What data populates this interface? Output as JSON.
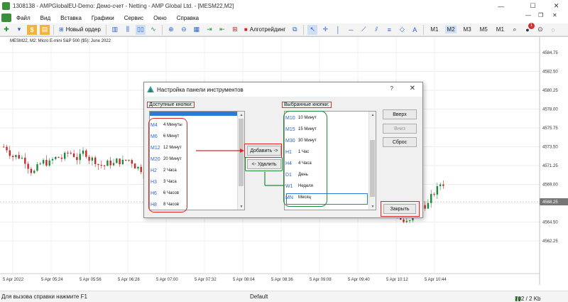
{
  "window": {
    "title": "1308138 - AMPGlobalEU-Demo: Демо-счет - Netting - AMP Global Ltd. - [MESM22,M2]",
    "minimize": "—",
    "maximize": "☐",
    "close": "✕"
  },
  "menu": {
    "items": [
      "Файл",
      "Вид",
      "Вставка",
      "Графики",
      "Сервис",
      "Окно",
      "Справка"
    ],
    "mdi_minimize": "—",
    "mdi_restore": "❐",
    "mdi_close": "✕"
  },
  "toolbar": {
    "new_order_label": "Новый ордер",
    "algotrading_label": "Алготрейдинг",
    "timeframes": [
      "M1",
      "M2",
      "M3",
      "M5",
      "M1"
    ],
    "active_timeframe_index": 1,
    "notification_count": "1"
  },
  "chart": {
    "symbol_line": "MESM22, M2:  Micro E-mini S&P 500 ($5): June 2022",
    "price_labels": [
      "4584.75",
      "4582.50",
      "4580.25",
      "4578.00",
      "4575.75",
      "4573.50",
      "4571.25",
      "4569.00",
      "4566.75",
      "4564.50",
      "4562.25"
    ],
    "current_price": "4568.25",
    "time_labels": [
      "5 Apr 2022",
      "5 Apr 05:24",
      "5 Apr 05:56",
      "5 Apr 06:28",
      "5 Apr 07:00",
      "5 Apr 07:32",
      "5 Apr 08:04",
      "5 Apr 08:36",
      "5 Apr 09:08",
      "5 Apr 09:40",
      "5 Apr 10:12",
      "5 Apr 10:44"
    ],
    "colors": {
      "bull": "#1e8a3a",
      "bear": "#c62828"
    }
  },
  "dialog": {
    "title": "Настройка панели инструментов",
    "help": "?",
    "close": "✕",
    "available_label": "Доступные кнопки:",
    "selected_label": "Выбранные кнопки:",
    "available_items": [
      {
        "tag": "M4",
        "label": "4 Минуты"
      },
      {
        "tag": "M6",
        "label": "6 Минут"
      },
      {
        "tag": "M12",
        "label": "12 Минут"
      },
      {
        "tag": "M20",
        "label": "20 Минут"
      },
      {
        "tag": "H2",
        "label": "2 Часа"
      },
      {
        "tag": "H3",
        "label": "3 Часа"
      },
      {
        "tag": "H6",
        "label": "6 Часов"
      },
      {
        "tag": "H8",
        "label": "8 Часов"
      }
    ],
    "selected_items": [
      {
        "tag": "M10",
        "label": "10 Минут"
      },
      {
        "tag": "M15",
        "label": "15 Минут"
      },
      {
        "tag": "M30",
        "label": "30 Минут"
      },
      {
        "tag": "H1",
        "label": "1 Час"
      },
      {
        "tag": "H4",
        "label": "4 Часа"
      },
      {
        "tag": "D1",
        "label": "День"
      },
      {
        "tag": "W1",
        "label": "Неделя"
      },
      {
        "tag": "MN",
        "label": "Месяц"
      }
    ],
    "add_button": "Добавить ->",
    "remove_button": "<- Удалить",
    "up_button": "Вверх",
    "down_button": "Вниз",
    "reset_button": "Сброс",
    "close_button": "Закрыть"
  },
  "statusbar": {
    "help_text": "Для вызова справки нажмите F1",
    "profile": "Default",
    "traffic": "702 / 2 Kb"
  }
}
